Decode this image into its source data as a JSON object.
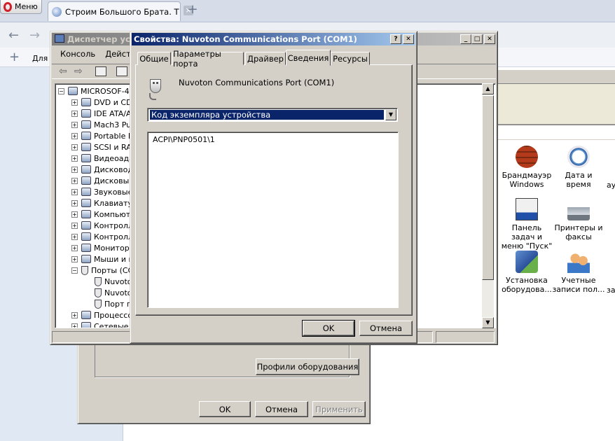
{
  "browser": {
    "menu_label": "Меню",
    "tab_title": "Строим Большого Брата. Т",
    "bookmark_label": "Для"
  },
  "sys_dialog": {
    "hardware_profiles_button": "Профили оборудования",
    "ok": "OK",
    "cancel": "Отмена",
    "apply": "Применить"
  },
  "devmgr": {
    "title": "Диспетчер устр",
    "menu": [
      "Консоль",
      "Действи"
    ],
    "tree": [
      {
        "label": "MICROSOF-4E",
        "expander": "−",
        "indent": 0,
        "icon": "computer-icon"
      },
      {
        "label": "DVD и CD-",
        "expander": "+",
        "indent": 1,
        "icon": "dvd-drive-icon"
      },
      {
        "label": "IDE ATA/A",
        "expander": "+",
        "indent": 1,
        "icon": "ide-controller-icon"
      },
      {
        "label": "Mach3 Puls",
        "expander": "+",
        "indent": 1,
        "icon": "mach3-icon"
      },
      {
        "label": "Portable D",
        "expander": "+",
        "indent": 1,
        "icon": "portable-device-icon"
      },
      {
        "label": "SCSI и RA",
        "expander": "+",
        "indent": 1,
        "icon": "scsi-icon"
      },
      {
        "label": "Видеоада",
        "expander": "+",
        "indent": 1,
        "icon": "video-adapter-icon"
      },
      {
        "label": "Дисковод",
        "expander": "+",
        "indent": 1,
        "icon": "floppy-icon"
      },
      {
        "label": "Дисковые",
        "expander": "+",
        "indent": 1,
        "icon": "disk-drive-icon"
      },
      {
        "label": "Звуковые",
        "expander": "+",
        "indent": 1,
        "icon": "sound-icon"
      },
      {
        "label": "Клавиату",
        "expander": "+",
        "indent": 1,
        "icon": "keyboard-icon"
      },
      {
        "label": "Компьюте",
        "expander": "+",
        "indent": 1,
        "icon": "computer-node-icon"
      },
      {
        "label": "Контролл",
        "expander": "+",
        "indent": 1,
        "icon": "controller-icon"
      },
      {
        "label": "Контролл",
        "expander": "+",
        "indent": 1,
        "icon": "usb-controller-icon"
      },
      {
        "label": "Монитор",
        "expander": "+",
        "indent": 1,
        "icon": "monitor-icon"
      },
      {
        "label": "Мыши и и",
        "expander": "+",
        "indent": 1,
        "icon": "mouse-icon"
      },
      {
        "label": "Порты (CO",
        "expander": "−",
        "indent": 1,
        "icon": "port-icon"
      },
      {
        "label": "Nuvoto",
        "expander": "",
        "indent": 2,
        "icon": "port-icon"
      },
      {
        "label": "Nuvoto",
        "expander": "",
        "indent": 2,
        "icon": "port-icon"
      },
      {
        "label": "Порт п",
        "expander": "",
        "indent": 2,
        "icon": "port-icon"
      },
      {
        "label": "Процессор",
        "expander": "+",
        "indent": 1,
        "icon": "processor-icon"
      },
      {
        "label": "Сетевые п",
        "expander": "+",
        "indent": 1,
        "icon": "network-adapter-icon"
      }
    ]
  },
  "control_panel": {
    "items": [
      {
        "label": "Брандмауэр Windows",
        "icon": "firewall-icon"
      },
      {
        "label": "Дата и время",
        "icon": "date-time-icon"
      },
      {
        "label": "Панель задач и меню \"Пуск\"",
        "icon": "taskbar-icon"
      },
      {
        "label": "Принтеры и факсы",
        "icon": "printer-icon"
      },
      {
        "label": "Установка оборудова...",
        "icon": "add-hardware-icon"
      },
      {
        "label": "Учетные записи пол...",
        "icon": "user-accounts-icon"
      }
    ],
    "clipped": [
      "ау",
      "за"
    ]
  },
  "props_dialog": {
    "title": "Свойства: Nuvoton Communications Port (COM1)",
    "help": "?",
    "close": "✕",
    "tabs": [
      "Общие",
      "Параметры порта",
      "Драйвер",
      "Сведения",
      "Ресурсы"
    ],
    "active_tab": "Сведения",
    "device_name": "Nuvoton Communications Port (COM1)",
    "property_selected": "Код экземпляра устройства",
    "value": "ACPI\\PNP0501\\1",
    "ok": "OK",
    "cancel": "Отмена"
  }
}
